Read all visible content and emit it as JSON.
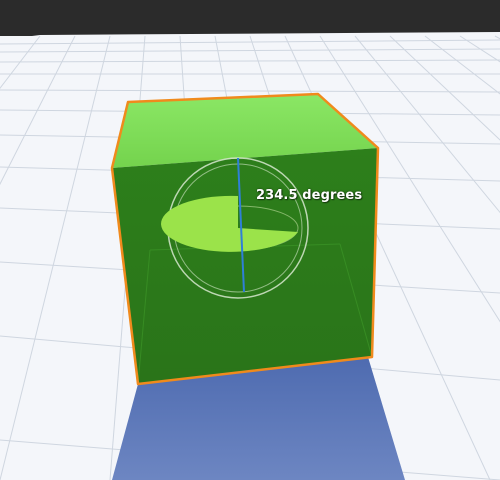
{
  "scene_view": {
    "background_color": "#2b2b2b",
    "ground_color": "#f4f6fa",
    "grid_color": "#cfd6e0",
    "shadow_color": "#5a76b8"
  },
  "selected_object": {
    "kind": "cube",
    "face_color_top": "#7fde57",
    "face_color_front": "#2b7a1a",
    "outline_color": "#f08a1c"
  },
  "rotation_gizmo": {
    "angle_label": "234.5 degrees",
    "angle_degrees": 234.5,
    "arc_fill_color": "#9be34a",
    "ring_color": "#ffffff",
    "axis_color": "#2f7fd8"
  },
  "icons": [
    "rotate-gizmo-icon"
  ]
}
